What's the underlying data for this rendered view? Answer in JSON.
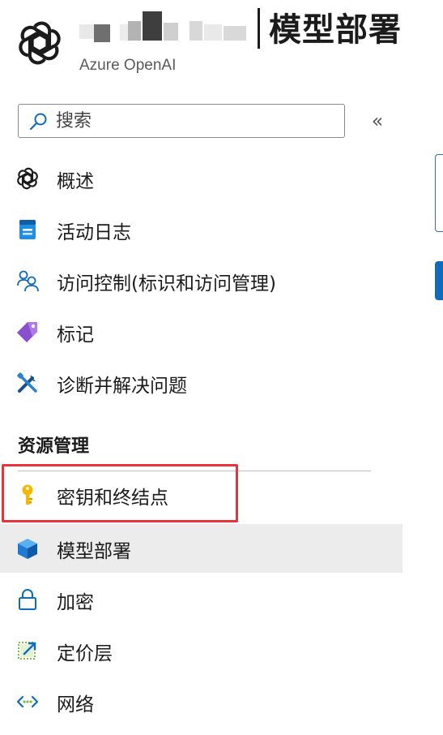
{
  "header": {
    "title": "模型部署",
    "subtitle": "Azure OpenAI"
  },
  "search": {
    "placeholder": "搜索",
    "value": ""
  },
  "collapse_glyph": "«",
  "nav": {
    "top_items": [
      {
        "label": "概述",
        "icon": "openai-icon"
      },
      {
        "label": "活动日志",
        "icon": "activity-log-icon"
      },
      {
        "label": "访问控制(标识和访问管理)",
        "icon": "people-icon"
      },
      {
        "label": "标记",
        "icon": "tag-icon"
      },
      {
        "label": "诊断并解决问题",
        "icon": "wrench-icon"
      }
    ],
    "section_heading": "资源管理",
    "resource_items": [
      {
        "label": "密钥和终结点",
        "icon": "key-icon",
        "highlighted": true
      },
      {
        "label": "模型部署",
        "icon": "cube-icon",
        "selected": true
      },
      {
        "label": "加密",
        "icon": "lock-icon"
      },
      {
        "label": "定价层",
        "icon": "pricing-tier-icon"
      },
      {
        "label": "网络",
        "icon": "network-icon"
      }
    ]
  },
  "colors": {
    "accent": "#0f6cbd",
    "highlight": "#e8333a",
    "selected_bg": "#ececec"
  }
}
